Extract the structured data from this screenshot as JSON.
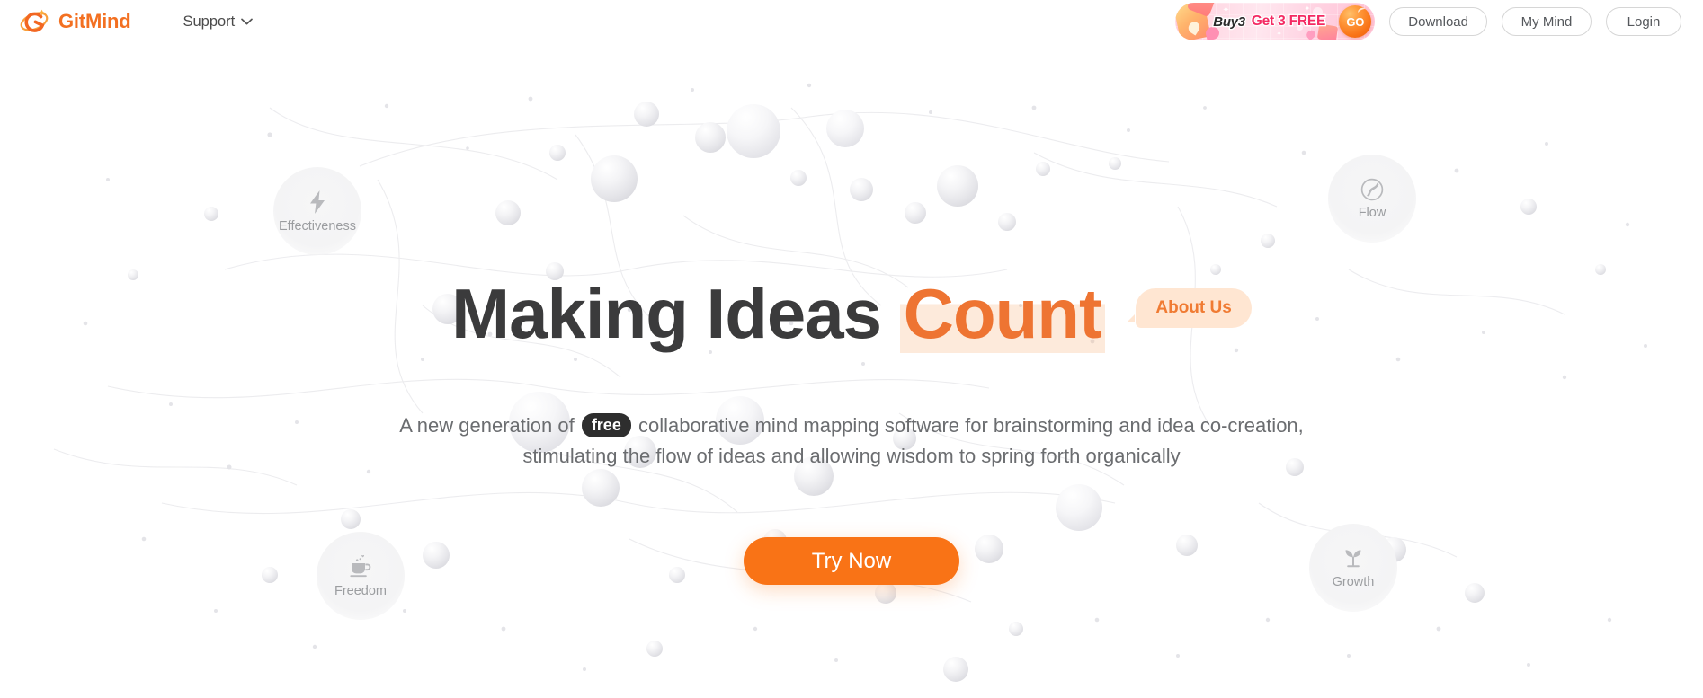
{
  "header": {
    "brand": {
      "name": "GitMind",
      "logo_icon": "gitmind-orbit-logo",
      "accent": "#f37021"
    },
    "nav": {
      "support_label": "Support",
      "chevron_icon": "chevron-down-icon"
    },
    "promo": {
      "buy_text": "Buy3",
      "get_text": "Get 3 FREE",
      "go_label": "GO",
      "go_icon": "go-button-icon",
      "gift_icon": "gift-box-icon",
      "heart_icon": "heart-icon",
      "background": "#ffd3e2",
      "get_color": "#f42b63"
    },
    "buttons": {
      "download": "Download",
      "my_mind": "My Mind",
      "login": "Login"
    }
  },
  "hero": {
    "headline_plain": "Making Ideas ",
    "headline_accent": "Count",
    "accent_color": "#ee7432",
    "about_bubble": "About Us",
    "subtitle_before": "A new generation of ",
    "subtitle_badge": "free",
    "subtitle_after": " collaborative mind mapping software for brainstorming and idea co-creation, stimulating the flow of ideas and allowing wisdom to spring forth organically",
    "cta_label": "Try Now",
    "cta_color": "#f97316"
  },
  "features": [
    {
      "id": "effectiveness",
      "label": "Effectiveness",
      "icon": "lightning-bolt-icon"
    },
    {
      "id": "flow",
      "label": "Flow",
      "icon": "winding-road-circle-icon"
    },
    {
      "id": "freedom",
      "label": "Freedom",
      "icon": "coffee-cup-icon"
    },
    {
      "id": "growth",
      "label": "Growth",
      "icon": "sprout-icon"
    }
  ],
  "background": {
    "icon": "network-spheres-background",
    "sphere_color": "#ececee",
    "link_color": "#e9e9ec"
  }
}
